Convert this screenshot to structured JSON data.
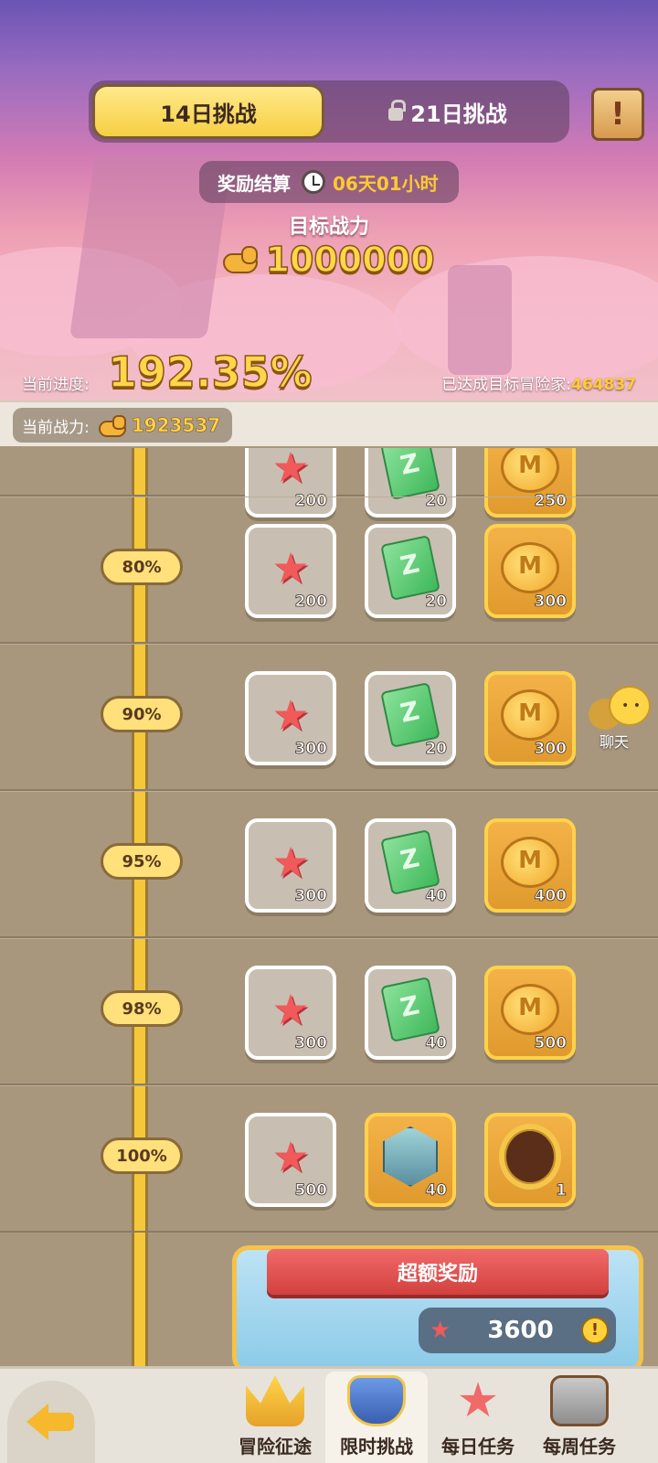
{
  "tabs": {
    "active": "14日挑战",
    "locked": "21日挑战"
  },
  "settlement": {
    "label": "奖励结算",
    "time": "06天01小时"
  },
  "target": {
    "title": "目标战力",
    "value": "1000000"
  },
  "progress": {
    "label": "当前进度:",
    "value": "192.35%",
    "achieved_label": "已达成目标冒险家:",
    "achieved_count": "464837"
  },
  "power": {
    "label": "当前战力:",
    "value": "1923537"
  },
  "partial_row": {
    "items": [
      {
        "icon": "starfish-icon",
        "qty": "200"
      },
      {
        "icon": "ticket-icon",
        "qty": "20"
      },
      {
        "icon": "coin-icon",
        "qty": "250"
      }
    ]
  },
  "tiers": [
    {
      "pct": "80%",
      "items": [
        {
          "icon": "starfish-icon",
          "qty": "200"
        },
        {
          "icon": "ticket-icon",
          "qty": "20"
        },
        {
          "icon": "coin-icon",
          "qty": "300"
        }
      ]
    },
    {
      "pct": "90%",
      "items": [
        {
          "icon": "starfish-icon",
          "qty": "300"
        },
        {
          "icon": "ticket-icon",
          "qty": "20"
        },
        {
          "icon": "coin-icon",
          "qty": "300"
        }
      ]
    },
    {
      "pct": "95%",
      "items": [
        {
          "icon": "starfish-icon",
          "qty": "300"
        },
        {
          "icon": "ticket-icon",
          "qty": "40"
        },
        {
          "icon": "coin-icon",
          "qty": "400"
        }
      ]
    },
    {
      "pct": "98%",
      "items": [
        {
          "icon": "starfish-icon",
          "qty": "300"
        },
        {
          "icon": "ticket-icon",
          "qty": "40"
        },
        {
          "icon": "coin-icon",
          "qty": "500"
        }
      ]
    },
    {
      "pct": "100%",
      "items": [
        {
          "icon": "starfish-icon",
          "qty": "500"
        },
        {
          "icon": "hero-shard-icon",
          "qty": "40"
        },
        {
          "icon": "avatar-frame-icon",
          "qty": "1"
        }
      ]
    }
  ],
  "bonus": {
    "title": "超额奖励",
    "value": "3600"
  },
  "chat": {
    "label": "聊天"
  },
  "nav": {
    "items": [
      {
        "label": "冒险征途",
        "icon": "crown-icon"
      },
      {
        "label": "限时挑战",
        "icon": "badge-icon"
      },
      {
        "label": "每日任务",
        "icon": "starfish-icon"
      },
      {
        "label": "每周任务",
        "icon": "chest-icon"
      }
    ],
    "active_index": 1
  },
  "colors": {
    "accent_gold": "#ffd64a",
    "track": "#f5c73a",
    "panel_brown": "#a8977d"
  }
}
